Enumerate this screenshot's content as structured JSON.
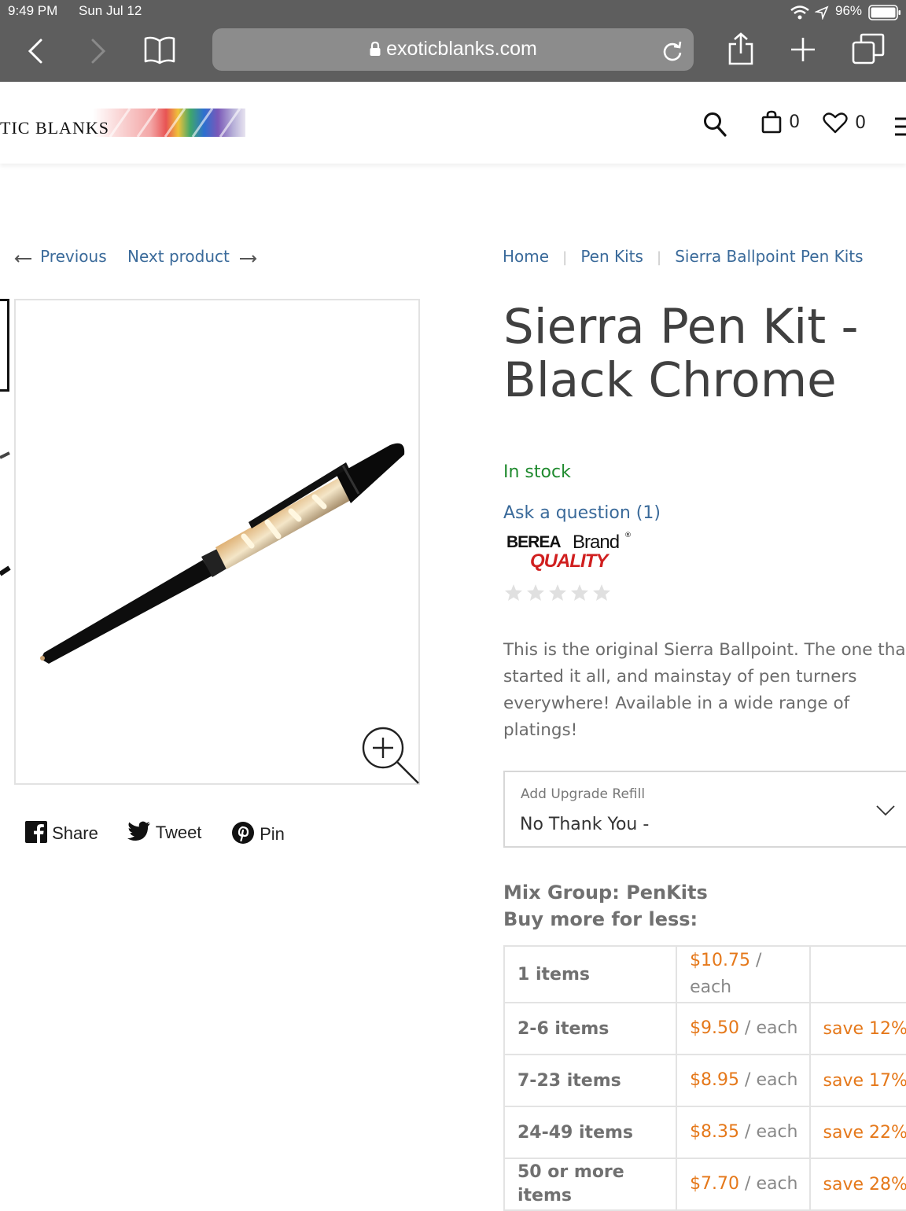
{
  "status_bar": {
    "time": "9:49 PM",
    "date": "Sun Jul 12",
    "battery": "96%"
  },
  "browser": {
    "url": "exoticblanks.com"
  },
  "site": {
    "logo_text": "Exotic Blanks",
    "logo_visible": "TIC BLANKS",
    "cart_count": "0",
    "wishlist_count": "0"
  },
  "nav": {
    "previous": "Previous",
    "next": "Next product"
  },
  "breadcrumb": [
    "Home",
    "Pen Kits",
    "Sierra Ballpoint Pen Kits"
  ],
  "product": {
    "title_line1": "Sierra Pen Kit -",
    "title_line2": "Black Chrome",
    "stock": "In stock",
    "ask_question": "Ask a question (1)",
    "badge_brand": "BEREA",
    "badge_brand2": "Brand",
    "badge_quality": "QUALITY",
    "description": "This is the original Sierra Ballpoint. The one that started it all, and mainstay of pen turners everywhere! Available in a wide range of platings!",
    "rating_stars": 0
  },
  "refill": {
    "label": "Add Upgrade Refill",
    "value": "No Thank You -"
  },
  "share": {
    "facebook": "Share",
    "twitter": "Tweet",
    "pinterest": "Pin"
  },
  "pricing": {
    "heading_line1": "Mix Group: PenKits",
    "heading_line2": "Buy more for less:",
    "each_suffix": " / each",
    "tiers": [
      {
        "qty": "1 items",
        "price": "$10.75",
        "save": ""
      },
      {
        "qty": "2-6 items",
        "price": "$9.50",
        "save": "save 12%"
      },
      {
        "qty": "7-23 items",
        "price": "$8.95",
        "save": "save 17%"
      },
      {
        "qty": "24-49 items",
        "price": "$8.35",
        "save": "save 22%"
      },
      {
        "qty": "50 or more items",
        "price": "$7.70",
        "save": "save 28%"
      }
    ]
  },
  "colors": {
    "link": "#3a6a9a",
    "in_stock": "#1f8a2e",
    "price": "#e5781a",
    "chrome_bg": "#5e5e5e"
  }
}
